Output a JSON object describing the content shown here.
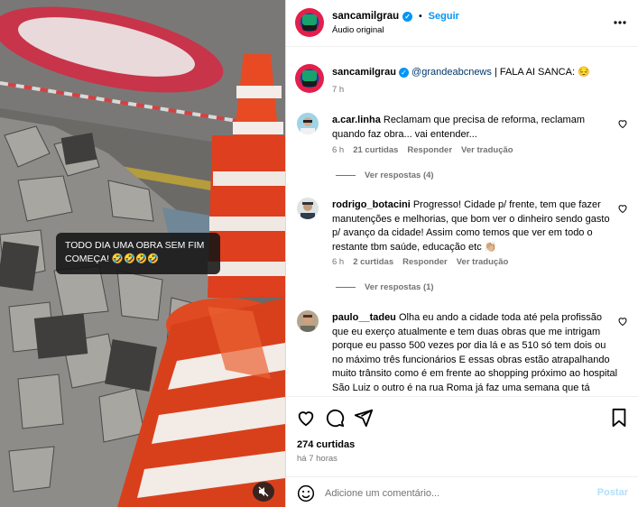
{
  "media": {
    "overlay_caption_line1": "TODO DIA UMA OBRA SEM FIM",
    "overlay_caption_line2": "COMEÇA! 🤣🤣🤣🤣",
    "mute_icon": "speaker-muted-icon"
  },
  "header": {
    "username": "sancamilgrau",
    "dot": "•",
    "follow_label": "Seguir",
    "audio_label": "Áudio original",
    "more_icon": "three-dots-icon"
  },
  "caption": {
    "username": "sancamilgrau",
    "mention": "@grandeabcnews",
    "text": " | FALA AI SANCA: 😔",
    "time": "7 h"
  },
  "comments": [
    {
      "username": "a.car.linha",
      "text": " Reclamam que precisa de reforma, reclamam quando faz obra... vai entender...",
      "time": "6 h",
      "likes": "21 curtidas",
      "reply_label": "Responder",
      "translate_label": "Ver tradução",
      "replies_label": "Ver respostas (4)"
    },
    {
      "username": "rodrigo_botacini",
      "text": " Progresso! Cidade p/ frente, tem que fazer manutenções e melhorias, que bom ver o dinheiro sendo gasto p/ avanço da cidade! Assim como temos que ver em todo o restante tbm saúde, educação etc 👏🏼",
      "time": "6 h",
      "likes": "2 curtidas",
      "reply_label": "Responder",
      "translate_label": "Ver tradução",
      "replies_label": "Ver respostas (1)"
    },
    {
      "username": "paulo__tadeu",
      "text": " Olha eu ando a cidade toda até pela profissão que eu exerço atualmente e tem duas obras que me intrigam porque eu passo 500 vezes por dia lá e as 510 só tem dois ou no máximo três funcionários E essas obras estão atrapalhando muito trânsito como é em frente ao shopping próximo ao hospital São Luiz o outro é na rua Roma já faz uma semana que tá fechada para baixo da rua Cavour você passa lá você vê"
    }
  ],
  "actions": {
    "like_icon": "heart-icon",
    "comment_icon": "comment-icon",
    "share_icon": "send-icon",
    "save_icon": "bookmark-icon",
    "likes_count": "274 curtidas",
    "posted_ago": "há 7 horas"
  },
  "add_comment": {
    "emoji_icon": "smiley-icon",
    "placeholder": "Adicione um comentário...",
    "post_label": "Postar"
  },
  "colors": {
    "accent": "#0095f6",
    "post_disabled": "#b2dffc",
    "muted_text": "#737373"
  }
}
